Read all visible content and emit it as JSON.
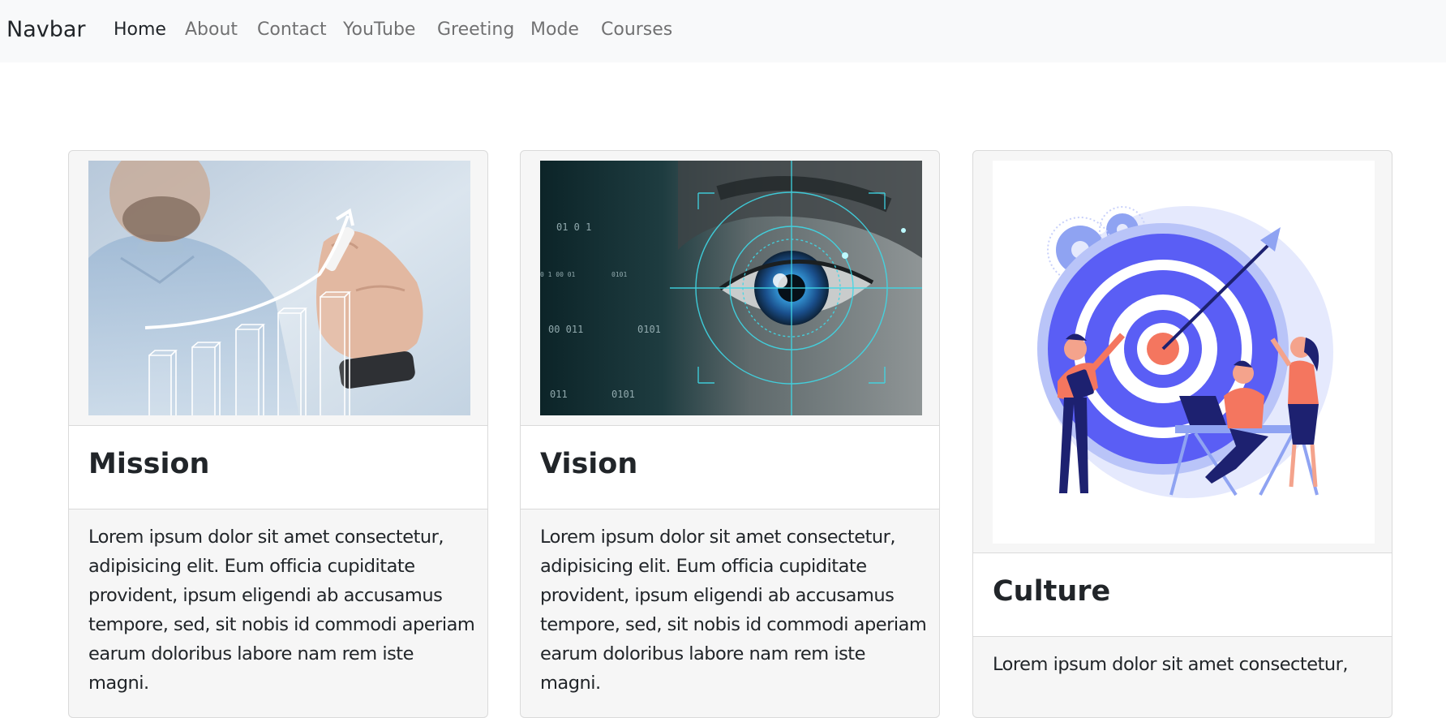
{
  "navbar": {
    "brand": "Navbar",
    "links": [
      "Home",
      "About",
      "Contact",
      "YouTube",
      "Greeting",
      "Mode",
      "Courses"
    ],
    "active_index": 0
  },
  "cards": [
    {
      "title": "Mission",
      "image_icon": "growth-chart-image",
      "text": "Lorem ipsum dolor sit amet consectetur, adipisicing elit. Eum officia cupiditate provident, ipsum eligendi ab accusamus tempore, sed, sit nobis id commodi aperiam earum doloribus labore nam rem iste magni."
    },
    {
      "title": "Vision",
      "image_icon": "eye-scan-image",
      "image_digits": [
        "01 0 1",
        "0 1 00 01",
        "0101",
        "00 011",
        "0101",
        "011",
        "0101"
      ],
      "text": "Lorem ipsum dolor sit amet consectetur, adipisicing elit. Eum officia cupiditate provident, ipsum eligendi ab accusamus tempore, sed, sit nobis id commodi aperiam earum doloribus labore nam rem iste magni."
    },
    {
      "title": "Culture",
      "image_icon": "target-team-illustration",
      "text": "Lorem ipsum dolor sit amet consectetur,"
    }
  ],
  "colors": {
    "navbar_bg": "#f8f9fa",
    "card_bg": "#f6f6f6",
    "target_blue": "#5a5ef5",
    "accent_orange": "#f4765f",
    "navy": "#1d2170"
  }
}
